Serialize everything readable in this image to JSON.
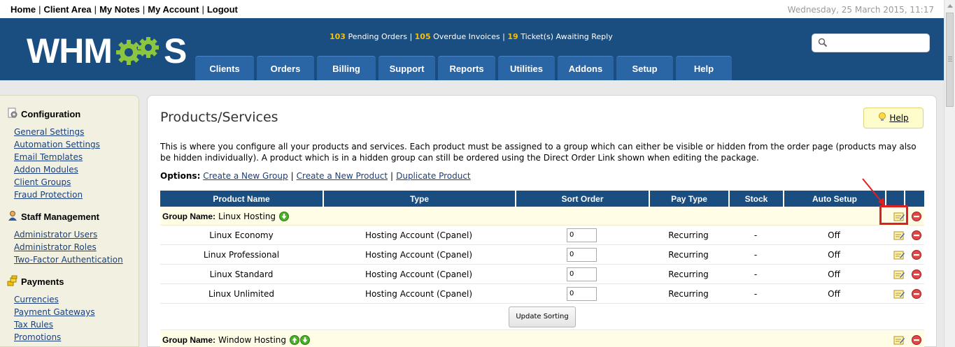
{
  "topbar": {
    "links": [
      "Home",
      "Client Area",
      "My Notes",
      "My Account",
      "Logout"
    ],
    "datetime": "Wednesday, 25 March 2015, 11:17"
  },
  "header": {
    "logo_left": "WHM",
    "logo_right": "S",
    "stats": {
      "pending_num": "103",
      "pending_label": "Pending Orders",
      "overdue_num": "105",
      "overdue_label": "Overdue Invoices",
      "tickets_num": "19",
      "tickets_label": "Ticket(s) Awaiting Reply",
      "sep": "|"
    },
    "search_placeholder": "",
    "nav": [
      "Clients",
      "Orders",
      "Billing",
      "Support",
      "Reports",
      "Utilities",
      "Addons",
      "Setup",
      "Help"
    ]
  },
  "sidebar": {
    "sections": [
      {
        "title": "Configuration",
        "icon": "gear-icon",
        "links": [
          "General Settings",
          "Automation Settings",
          "Email Templates",
          "Addon Modules",
          "Client Groups",
          "Fraud Protection"
        ]
      },
      {
        "title": "Staff Management",
        "icon": "staff-icon",
        "links": [
          "Administrator Users",
          "Administrator Roles",
          "Two-Factor Authentication"
        ]
      },
      {
        "title": "Payments",
        "icon": "coins-icon",
        "links": [
          "Currencies",
          "Payment Gateways",
          "Tax Rules",
          "Promotions"
        ]
      }
    ]
  },
  "main": {
    "title": "Products/Services",
    "help_label": "Help",
    "intro": "This is where you configure all your products and services. Each product must be assigned to a group which can either be visible or hidden from the order page (products may also be hidden individually). A product which is in a hidden group can still be ordered using the Direct Order Link shown when editing the package.",
    "options_label": "Options:",
    "options": [
      "Create a New Group",
      "Create a New Product",
      "Duplicate Product"
    ],
    "table": {
      "headers": [
        "Product Name",
        "Type",
        "Sort Order",
        "Pay Type",
        "Stock",
        "Auto Setup"
      ],
      "group_label": "Group Name:",
      "groups": [
        {
          "name": "Linux Hosting",
          "products": [
            {
              "name": "Linux Economy",
              "type": "Hosting Account (Cpanel)",
              "sort": "0",
              "pay": "Recurring",
              "stock": "-",
              "auto": "Off"
            },
            {
              "name": "Linux Professional",
              "type": "Hosting Account (Cpanel)",
              "sort": "0",
              "pay": "Recurring",
              "stock": "-",
              "auto": "Off"
            },
            {
              "name": "Linux Standard",
              "type": "Hosting Account (Cpanel)",
              "sort": "0",
              "pay": "Recurring",
              "stock": "-",
              "auto": "Off"
            },
            {
              "name": "Linux Unlimited",
              "type": "Hosting Account (Cpanel)",
              "sort": "0",
              "pay": "Recurring",
              "stock": "-",
              "auto": "Off"
            }
          ]
        },
        {
          "name": "Window Hosting",
          "products": []
        }
      ],
      "update_label": "Update Sorting"
    }
  },
  "colors": {
    "header_bg": "#1a4d80",
    "tab_bg": "#2a65a6",
    "stat_num": "#f5c000",
    "logo_gear": "#8cc63f",
    "highlight": "#e02020"
  }
}
